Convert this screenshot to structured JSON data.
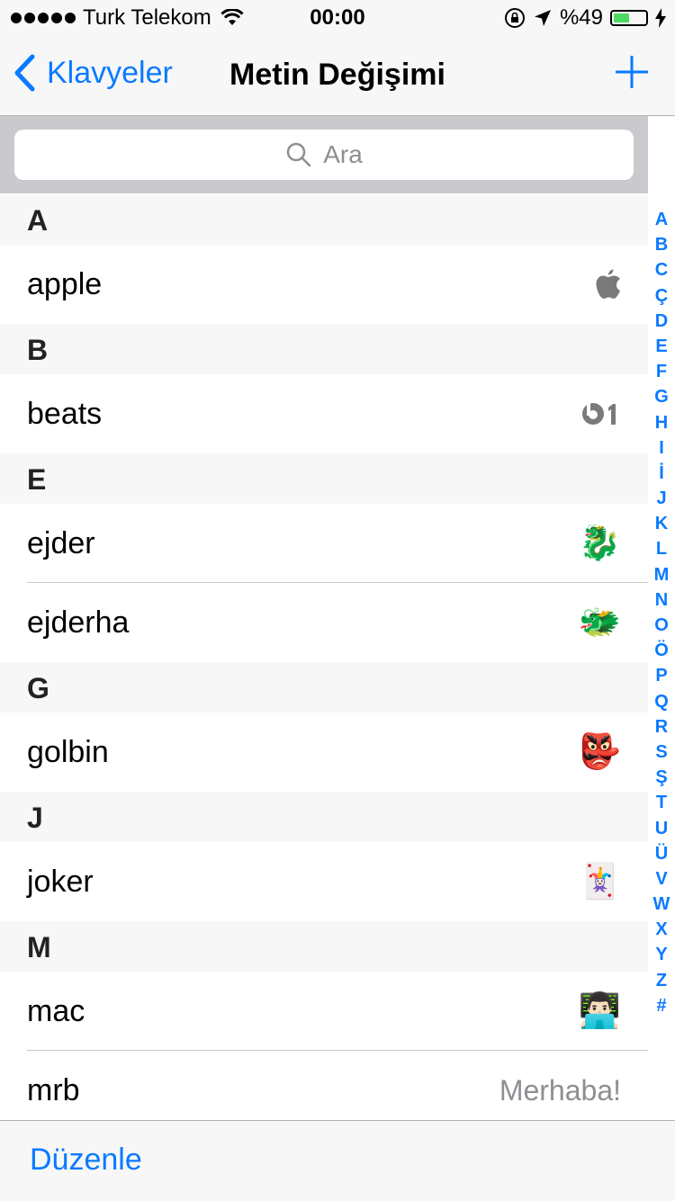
{
  "status_bar": {
    "carrier": "Turk Telekom",
    "time": "00:00",
    "battery_percent": "%49",
    "battery_level": 0.49
  },
  "nav": {
    "back_label": "Klavyeler",
    "title": "Metin Değişimi"
  },
  "search": {
    "placeholder": "Ara"
  },
  "sections": [
    {
      "header": "A",
      "rows": [
        {
          "shortcut": "apple",
          "phrase_icon": "apple-logo-icon"
        }
      ]
    },
    {
      "header": "B",
      "rows": [
        {
          "shortcut": "beats",
          "phrase_icon": "beats1-logo-icon"
        }
      ]
    },
    {
      "header": "E",
      "rows": [
        {
          "shortcut": "ejder",
          "phrase": "🐉"
        },
        {
          "shortcut": "ejderha",
          "phrase": "🐲"
        }
      ]
    },
    {
      "header": "G",
      "rows": [
        {
          "shortcut": "golbin",
          "phrase": "👺"
        }
      ]
    },
    {
      "header": "J",
      "rows": [
        {
          "shortcut": "joker",
          "phrase": "🃏"
        }
      ]
    },
    {
      "header": "M",
      "rows": [
        {
          "shortcut": "mac",
          "phrase": "👨🏻‍💻"
        },
        {
          "shortcut": "mrb",
          "phrase": "Merhaba!"
        }
      ]
    }
  ],
  "index_letters": [
    "A",
    "B",
    "C",
    "Ç",
    "D",
    "E",
    "F",
    "G",
    "H",
    "I",
    "İ",
    "J",
    "K",
    "L",
    "M",
    "N",
    "O",
    "Ö",
    "P",
    "Q",
    "R",
    "S",
    "Ş",
    "T",
    "U",
    "Ü",
    "V",
    "W",
    "X",
    "Y",
    "Z",
    "#"
  ],
  "toolbar": {
    "edit_label": "Düzenle"
  },
  "colors": {
    "accent": "#0a7aff",
    "battery": "#4cd964",
    "header_bg": "#f7f7f7",
    "secondary_text": "#8e8e93"
  }
}
